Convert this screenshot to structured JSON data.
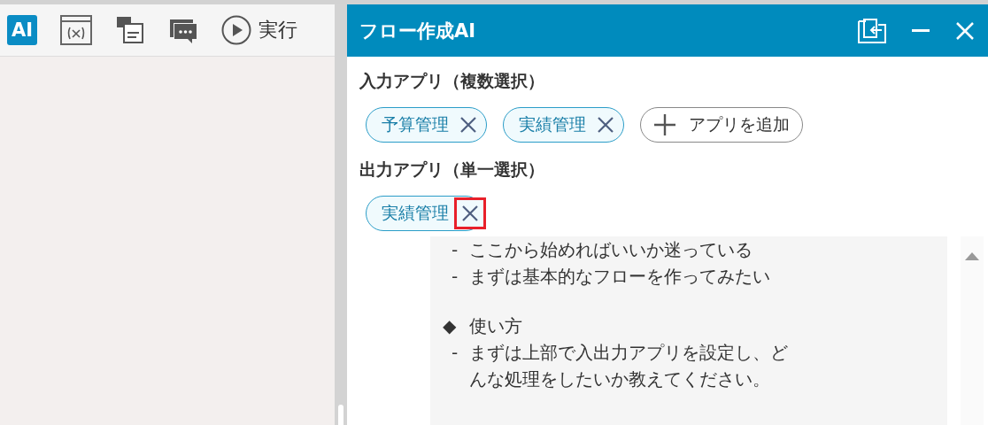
{
  "toolbar": {
    "items": [
      {
        "kind": "ai",
        "label": "AI"
      },
      {
        "kind": "variable"
      },
      {
        "kind": "comments"
      },
      {
        "kind": "chat"
      },
      {
        "kind": "run",
        "label": "実行"
      }
    ]
  },
  "panel": {
    "title": "フロー作成AI",
    "buttons": [
      {
        "kind": "dock"
      },
      {
        "kind": "minimize"
      },
      {
        "kind": "close"
      }
    ],
    "input_apps": {
      "label": "入力アプリ（複数選択）",
      "chips": [
        {
          "label": "予算管理",
          "highlighted": false
        },
        {
          "label": "実績管理",
          "highlighted": false
        }
      ],
      "add_button": "アプリを追加"
    },
    "output_apps": {
      "label": "出力アプリ（単一選択）",
      "chips": [
        {
          "label": "実績管理",
          "highlighted": true
        }
      ]
    },
    "message": [
      {
        "kind": "bullet",
        "marker": "-",
        "text": "ここから始めればいいか迷っている"
      },
      {
        "kind": "bullet",
        "marker": "-",
        "text": "まずは基本的なフローを作ってみたい"
      },
      {
        "kind": "heading",
        "marker": "◆",
        "text": "使い方"
      },
      {
        "kind": "bullet",
        "marker": "-",
        "text": "まずは上部で入出力アプリを設定し、どんな処理をしたいか教えてください。"
      }
    ]
  }
}
